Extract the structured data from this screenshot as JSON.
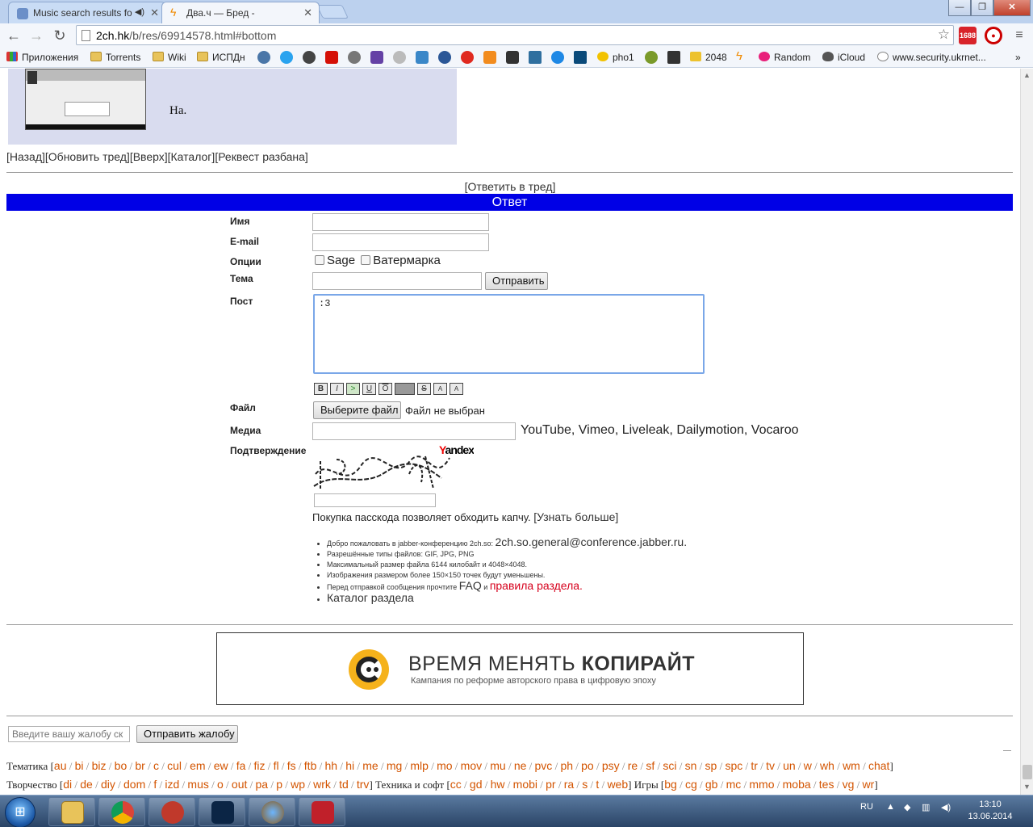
{
  "browser": {
    "tabs": [
      {
        "title": "Music search results fo",
        "active": false
      },
      {
        "title": "Два.ч — Бред -",
        "active": true
      }
    ],
    "url_host": "2ch.hk",
    "url_path": "/b/res/69914578.html#bottom",
    "ext_badge": "1688",
    "bookmarks": [
      {
        "label": "Приложения"
      },
      {
        "label": "Torrents"
      },
      {
        "label": "Wiki"
      },
      {
        "label": "ИСПДн"
      },
      {
        "label": "pho1"
      },
      {
        "label": "2048"
      },
      {
        "label": "Random"
      },
      {
        "label": "iCloud"
      },
      {
        "label": "www.security.ukrnet..."
      }
    ],
    "overflow": "»"
  },
  "post": {
    "text": "На."
  },
  "nav": {
    "back": "[Назад]",
    "refresh": "[Обновить тред]",
    "up": "[Вверх]",
    "catalog": "[Каталог]",
    "unban": "[Реквест разбана]"
  },
  "reply": {
    "open_link": "[Ответить в тред]",
    "bar_title": "Ответ",
    "labels": {
      "name": "Имя",
      "email": "E-mail",
      "options": "Опции",
      "subject": "Тема",
      "post": "Пост",
      "file": "Файл",
      "media": "Медиа",
      "confirm": "Подтверждение"
    },
    "options": {
      "sage": "Sage",
      "watermark": "Ватермарка"
    },
    "submit": "Отправить",
    "post_text": ":3",
    "format_buttons": [
      "B",
      "I",
      ">",
      "U",
      "O",
      "",
      "S",
      "A",
      "A"
    ],
    "choose_file": "Выберите файл",
    "no_file": "Файл не выбран",
    "media_hosts": "YouTube, Vimeo, Liveleak, Dailymotion, Vocaroo",
    "captcha_brand_y": "Y",
    "captcha_brand_rest": "andex",
    "passcode_text": "Покупка пасскода позволяет обходить капчу.",
    "passcode_link": "[Узнать больше]",
    "rules": {
      "jabber_prefix": "Добро пожаловать в jabber-конференцию 2ch.so:",
      "jabber_address": "2ch.so.general@conference.jabber.ru.",
      "types": "Разрешённые типы файлов: GIF, JPG, PNG",
      "max_size": "Максимальный размер файла 6144 килобайт и 4048×4048.",
      "resize": "Изображения размером более 150×150 точек будут уменьшены.",
      "read_prefix": "Перед отправкой сообщения прочтите",
      "faq": "FAQ",
      "and": "и",
      "board_rules": "правила раздела.",
      "catalog": "Каталог раздела"
    }
  },
  "banner": {
    "title_light": "ВРЕМЯ МЕНЯТЬ",
    "title_bold": "КОПИРАЙТ",
    "subtitle": "Кампания по реформе авторского права в цифровую эпоху"
  },
  "complaint": {
    "placeholder": "Введите вашу жалобу ск",
    "button": "Отправить жалобу"
  },
  "boards": {
    "themes_label": "Тематика",
    "themes": [
      "au",
      "bi",
      "biz",
      "bo",
      "br",
      "c",
      "cul",
      "em",
      "ew",
      "fa",
      "fiz",
      "fl",
      "fs",
      "ftb",
      "hh",
      "hi",
      "me",
      "mg",
      "mlp",
      "mo",
      "mov",
      "mu",
      "ne",
      "pvc",
      "ph",
      "po",
      "psy",
      "re",
      "sf",
      "sci",
      "sn",
      "sp",
      "spc",
      "tr",
      "tv",
      "un",
      "w",
      "wh",
      "wm",
      "chat"
    ],
    "creative_label": "Творчество",
    "creative": [
      "di",
      "de",
      "diy",
      "dom",
      "f",
      "izd",
      "mus",
      "o",
      "out",
      "pa",
      "p",
      "wp",
      "wrk",
      "td",
      "trv"
    ],
    "tech_label": "Техника и софт",
    "tech": [
      "cc",
      "gd",
      "hw",
      "mobi",
      "pr",
      "ra",
      "s",
      "t",
      "web"
    ],
    "games_label": "Игры",
    "games": [
      "bg",
      "cg",
      "gb",
      "mc",
      "mmo",
      "moba",
      "tes",
      "vg",
      "wr"
    ]
  },
  "taskbar": {
    "lang": "RU",
    "time": "13:10",
    "date": "13.06.2014"
  }
}
